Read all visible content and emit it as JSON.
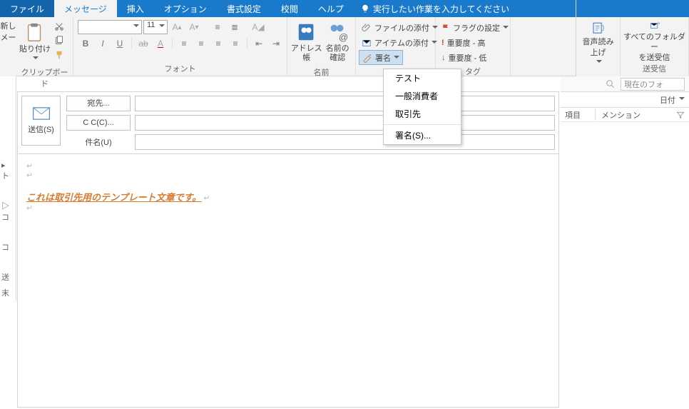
{
  "tabs": {
    "file": "ファイル",
    "message": "メッセージ",
    "insert": "挿入",
    "options": "オプション",
    "format": "書式設定",
    "review": "校閲",
    "help": "ヘルプ",
    "tellme": "実行したい作業を入力してください"
  },
  "left_trunc": {
    "l1": "新し",
    "l2": "メー"
  },
  "clipboard": {
    "paste": "貼り付け",
    "label": "クリップボード"
  },
  "font": {
    "name": "",
    "size": "11",
    "label": "フォント"
  },
  "names": {
    "address": "アドレス帳",
    "check": "名前の\n確認",
    "label": "名前"
  },
  "attach": {
    "file": "ファイルの添付",
    "item": "アイテムの添付",
    "sig": "署名"
  },
  "tag": {
    "flag": "フラグの設定",
    "hi": "重要度 - 高",
    "lo": "重要度 - 低",
    "label": "タグ"
  },
  "voice": {
    "read": "音声読み\n上げ"
  },
  "sendrecv": {
    "all": "すべてのフォルダー\nを送受信",
    "label": "送受信"
  },
  "search": {
    "ph": "現在のフォ"
  },
  "sort": {
    "date": "日付"
  },
  "list": {
    "col1": "項目",
    "col2": "メンション"
  },
  "sig_menu": {
    "i1": "テスト",
    "i2": "一般消費者",
    "i3": "取引先",
    "i4": "署名(S)..."
  },
  "send": {
    "label": "送信(S)"
  },
  "fields": {
    "to": "宛先...",
    "cc": "C C(C)...",
    "subj": "件名(U)"
  },
  "body": {
    "tpl": "これは取引先用のテンプレート文章です。"
  },
  "leftbar": {
    "a": "▸ ト",
    "b": "▷ コ",
    "c": "   コ",
    "d": " 送",
    "e": "   末"
  }
}
